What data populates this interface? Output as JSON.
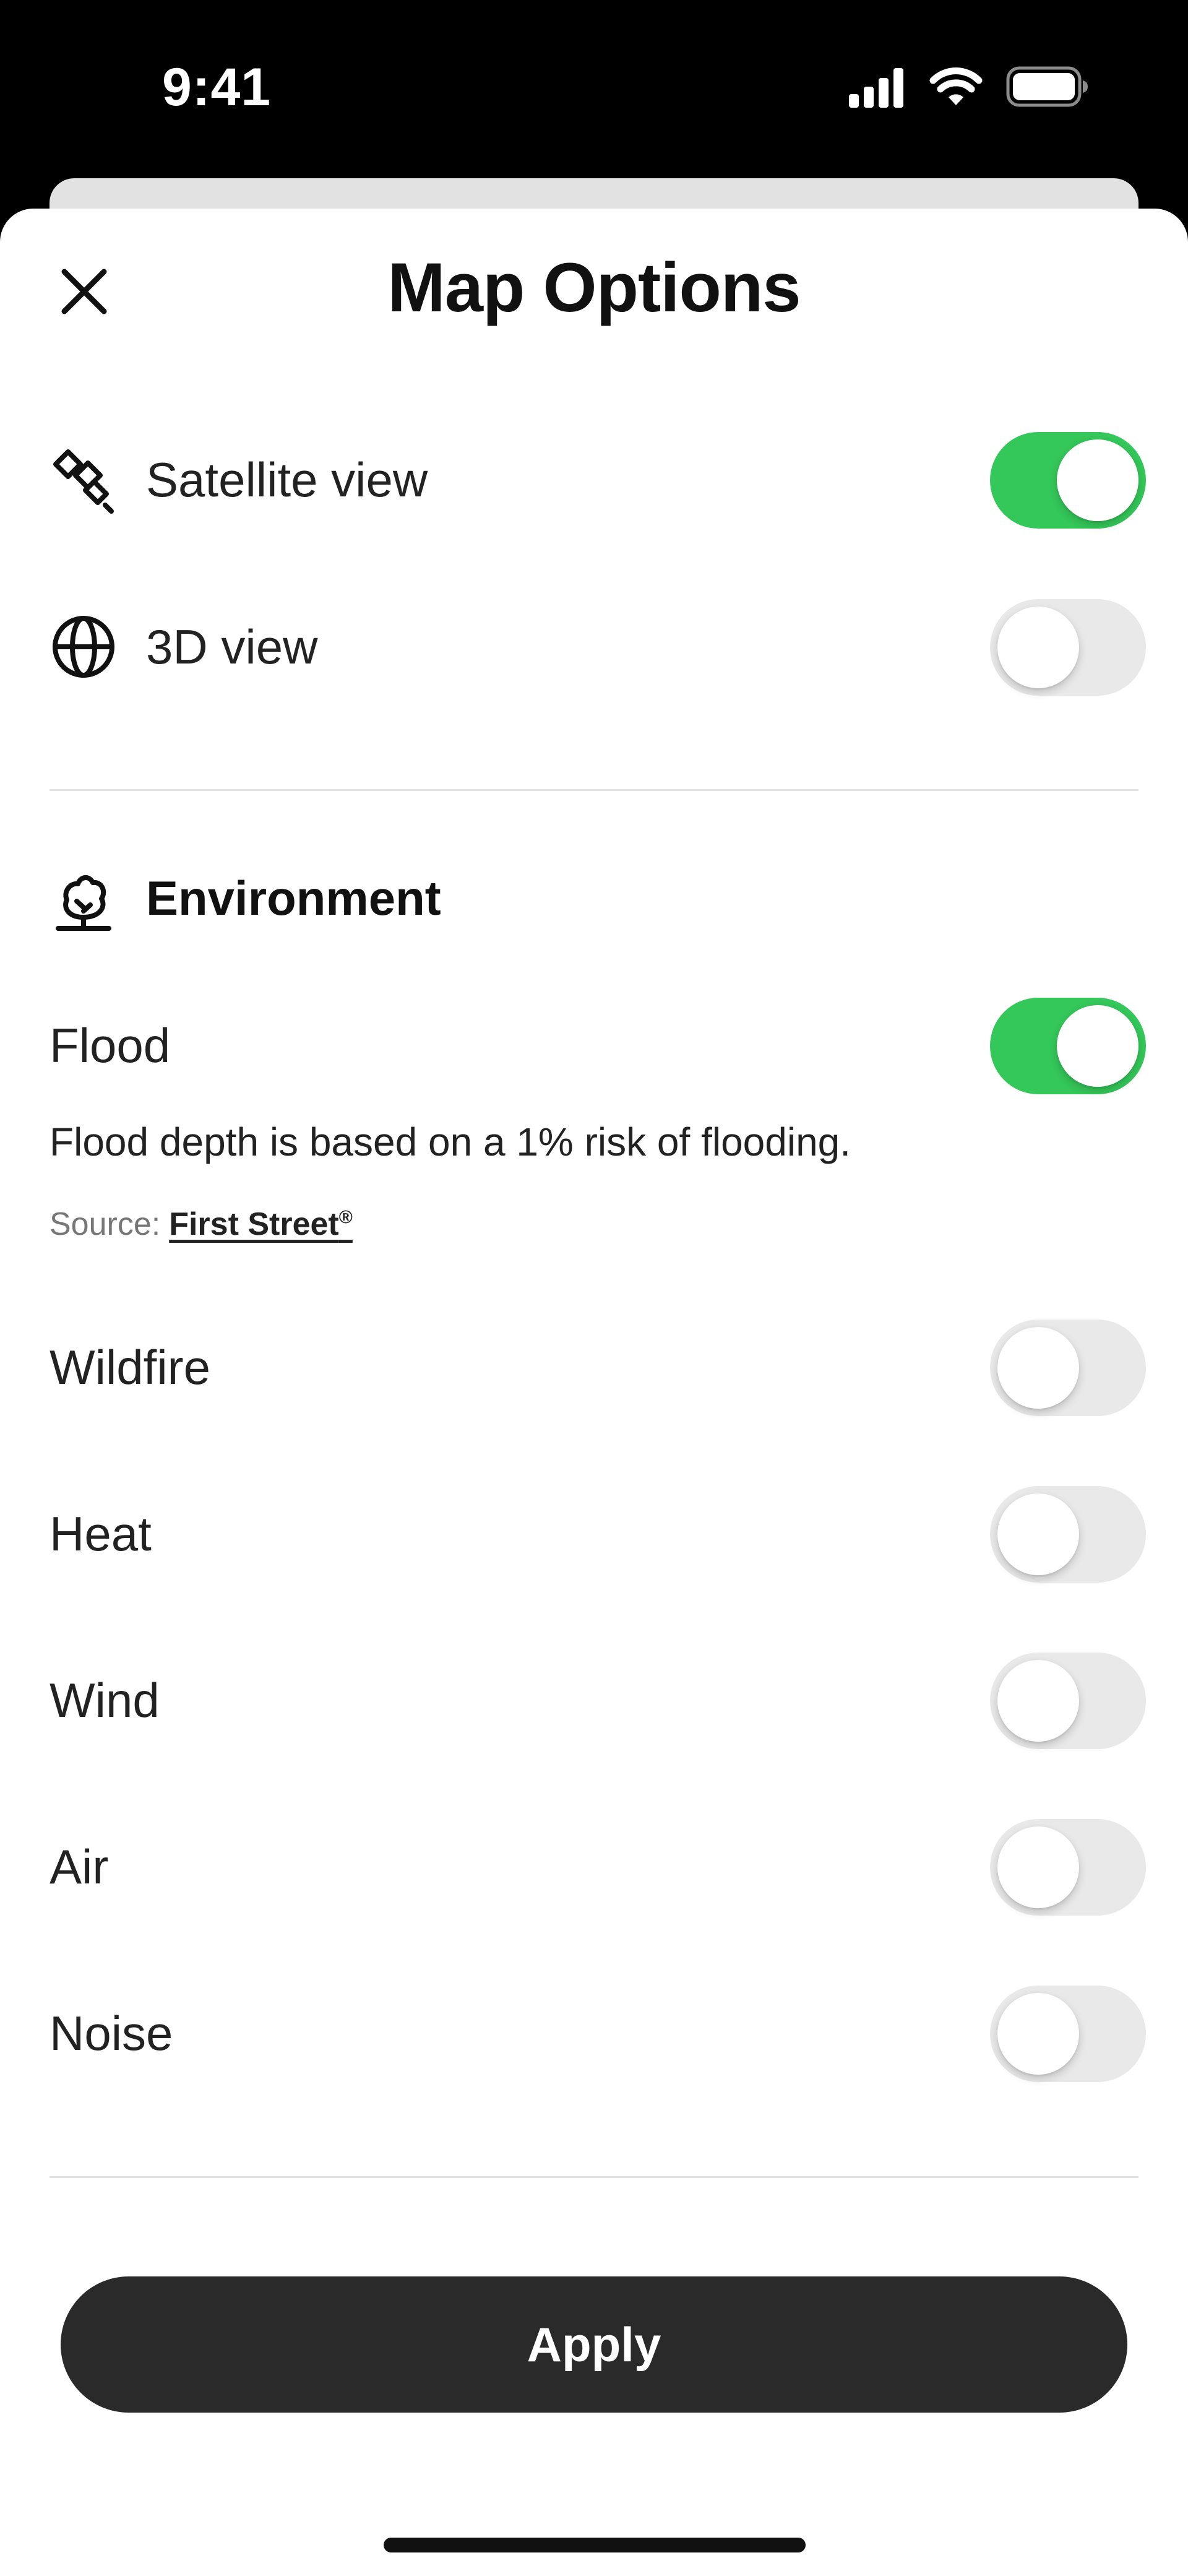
{
  "status_bar": {
    "time": "9:41",
    "icons": [
      "signal-icon",
      "wifi-icon",
      "battery-icon"
    ]
  },
  "header": {
    "title": "Map Options",
    "close_icon": "close-icon"
  },
  "view_options": [
    {
      "label": "Satellite view",
      "icon": "satellite-icon",
      "enabled": true
    },
    {
      "label": "3D view",
      "icon": "globe-icon",
      "enabled": false
    }
  ],
  "environment": {
    "title": "Environment",
    "icon": "tree-icon",
    "flood": {
      "label": "Flood",
      "enabled": true,
      "description": "Flood depth is based on a 1% risk of flooding.",
      "source_prefix": "Source:",
      "source_link": "First Street",
      "source_mark": "®"
    },
    "layers": [
      {
        "label": "Wildfire",
        "enabled": false
      },
      {
        "label": "Heat",
        "enabled": false
      },
      {
        "label": "Wind",
        "enabled": false
      },
      {
        "label": "Air",
        "enabled": false
      },
      {
        "label": "Noise",
        "enabled": false
      }
    ]
  },
  "footer": {
    "apply_label": "Apply"
  },
  "colors": {
    "toggle_on": "#34c759",
    "toggle_off": "#e9e9ea",
    "apply_button": "#2a2a2a"
  }
}
